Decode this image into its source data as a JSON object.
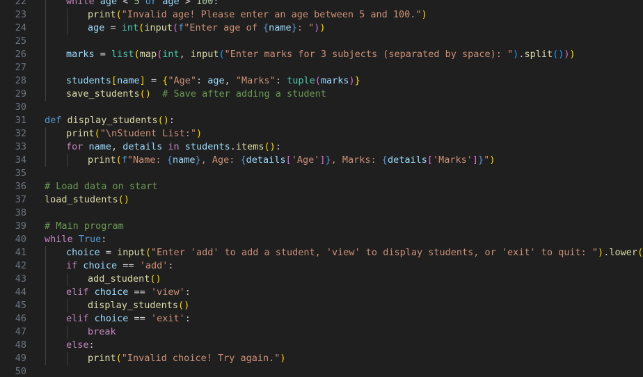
{
  "editor": {
    "language": "python",
    "theme": "dark",
    "colors": {
      "background": "#1f1f1f",
      "line_number": "#6e7681",
      "keyword": "#569cd6",
      "control": "#c586c0",
      "function": "#dcdcaa",
      "variable": "#9cdcfe",
      "string": "#ce9178",
      "number": "#b5cea8",
      "comment": "#6a9955",
      "bracket_1": "#ffd700",
      "bracket_2": "#da70d6",
      "bracket_3": "#179fff"
    },
    "lines": [
      {
        "number": "22",
        "indent": 1,
        "tokens": [
          {
            "t": "while",
            "c": "ctrl"
          },
          {
            "t": " age ",
            "c": "var"
          },
          {
            "t": "< ",
            "c": "op"
          },
          {
            "t": "5",
            "c": "num"
          },
          {
            "t": " or ",
            "c": "kw"
          },
          {
            "t": "age",
            "c": "var"
          },
          {
            "t": " > ",
            "c": "op"
          },
          {
            "t": "100",
            "c": "num"
          },
          {
            "t": ":",
            "c": "plain"
          }
        ]
      },
      {
        "number": "23",
        "indent": 2,
        "tokens": [
          {
            "t": "print",
            "c": "fn"
          },
          {
            "t": "(",
            "c": "p1"
          },
          {
            "t": "\"Invalid age! Please enter an age between 5 and 100.\"",
            "c": "str"
          },
          {
            "t": ")",
            "c": "p1"
          }
        ]
      },
      {
        "number": "24",
        "indent": 2,
        "tokens": [
          {
            "t": "age",
            "c": "var"
          },
          {
            "t": " = ",
            "c": "op"
          },
          {
            "t": "int",
            "c": "type"
          },
          {
            "t": "(",
            "c": "p1"
          },
          {
            "t": "input",
            "c": "fn"
          },
          {
            "t": "(",
            "c": "p2"
          },
          {
            "t": "f",
            "c": "kw"
          },
          {
            "t": "\"Enter age of ",
            "c": "str"
          },
          {
            "t": "{",
            "c": "kw"
          },
          {
            "t": "name",
            "c": "var"
          },
          {
            "t": "}",
            "c": "kw"
          },
          {
            "t": ": \"",
            "c": "str"
          },
          {
            "t": ")",
            "c": "p2"
          },
          {
            "t": ")",
            "c": "p1"
          }
        ]
      },
      {
        "number": "25",
        "indent": 1,
        "tokens": []
      },
      {
        "number": "26",
        "indent": 1,
        "tokens": [
          {
            "t": "marks",
            "c": "var"
          },
          {
            "t": " = ",
            "c": "op"
          },
          {
            "t": "list",
            "c": "type"
          },
          {
            "t": "(",
            "c": "p1"
          },
          {
            "t": "map",
            "c": "fn"
          },
          {
            "t": "(",
            "c": "p2"
          },
          {
            "t": "int",
            "c": "type"
          },
          {
            "t": ", ",
            "c": "plain"
          },
          {
            "t": "input",
            "c": "fn"
          },
          {
            "t": "(",
            "c": "p3"
          },
          {
            "t": "\"Enter marks for 3 subjects (separated by space): \"",
            "c": "str"
          },
          {
            "t": ")",
            "c": "p3"
          },
          {
            "t": ".",
            "c": "plain"
          },
          {
            "t": "split",
            "c": "fn"
          },
          {
            "t": "(",
            "c": "p3"
          },
          {
            "t": ")",
            "c": "p3"
          },
          {
            "t": ")",
            "c": "p2"
          },
          {
            "t": ")",
            "c": "p1"
          }
        ]
      },
      {
        "number": "27",
        "indent": 1,
        "tokens": []
      },
      {
        "number": "28",
        "indent": 1,
        "tokens": [
          {
            "t": "students",
            "c": "var"
          },
          {
            "t": "[",
            "c": "p1"
          },
          {
            "t": "name",
            "c": "var"
          },
          {
            "t": "]",
            "c": "p1"
          },
          {
            "t": " = ",
            "c": "op"
          },
          {
            "t": "{",
            "c": "p1"
          },
          {
            "t": "\"Age\"",
            "c": "str"
          },
          {
            "t": ": ",
            "c": "plain"
          },
          {
            "t": "age",
            "c": "var"
          },
          {
            "t": ", ",
            "c": "plain"
          },
          {
            "t": "\"Marks\"",
            "c": "str"
          },
          {
            "t": ": ",
            "c": "plain"
          },
          {
            "t": "tuple",
            "c": "type"
          },
          {
            "t": "(",
            "c": "p2"
          },
          {
            "t": "marks",
            "c": "var"
          },
          {
            "t": ")",
            "c": "p2"
          },
          {
            "t": "}",
            "c": "p1"
          }
        ]
      },
      {
        "number": "29",
        "indent": 1,
        "tokens": [
          {
            "t": "save_students",
            "c": "fn"
          },
          {
            "t": "(",
            "c": "p1"
          },
          {
            "t": ")",
            "c": "p1"
          },
          {
            "t": "  ",
            "c": "plain"
          },
          {
            "t": "# Save after adding a student",
            "c": "com"
          }
        ]
      },
      {
        "number": "30",
        "indent": 0,
        "tokens": []
      },
      {
        "number": "31",
        "indent": 0,
        "tokens": [
          {
            "t": "def",
            "c": "kw"
          },
          {
            "t": " ",
            "c": "plain"
          },
          {
            "t": "display_students",
            "c": "fn"
          },
          {
            "t": "(",
            "c": "p1"
          },
          {
            "t": ")",
            "c": "p1"
          },
          {
            "t": ":",
            "c": "plain"
          }
        ]
      },
      {
        "number": "32",
        "indent": 1,
        "tokens": [
          {
            "t": "print",
            "c": "fn"
          },
          {
            "t": "(",
            "c": "p1"
          },
          {
            "t": "\"",
            "c": "str"
          },
          {
            "t": "\\n",
            "c": "str"
          },
          {
            "t": "Student List:\"",
            "c": "str"
          },
          {
            "t": ")",
            "c": "p1"
          }
        ]
      },
      {
        "number": "33",
        "indent": 1,
        "tokens": [
          {
            "t": "for",
            "c": "ctrl"
          },
          {
            "t": " name",
            "c": "var"
          },
          {
            "t": ", ",
            "c": "plain"
          },
          {
            "t": "details",
            "c": "var"
          },
          {
            "t": " in ",
            "c": "ctrl"
          },
          {
            "t": "students",
            "c": "var"
          },
          {
            "t": ".",
            "c": "plain"
          },
          {
            "t": "items",
            "c": "fn"
          },
          {
            "t": "(",
            "c": "p1"
          },
          {
            "t": ")",
            "c": "p1"
          },
          {
            "t": ":",
            "c": "plain"
          }
        ]
      },
      {
        "number": "34",
        "indent": 2,
        "tokens": [
          {
            "t": "print",
            "c": "fn"
          },
          {
            "t": "(",
            "c": "p1"
          },
          {
            "t": "f",
            "c": "kw"
          },
          {
            "t": "\"Name: ",
            "c": "str"
          },
          {
            "t": "{",
            "c": "kw"
          },
          {
            "t": "name",
            "c": "var"
          },
          {
            "t": "}",
            "c": "kw"
          },
          {
            "t": ", Age: ",
            "c": "str"
          },
          {
            "t": "{",
            "c": "kw"
          },
          {
            "t": "details",
            "c": "var"
          },
          {
            "t": "[",
            "c": "p2"
          },
          {
            "t": "'Age'",
            "c": "str"
          },
          {
            "t": "]",
            "c": "p2"
          },
          {
            "t": "}",
            "c": "kw"
          },
          {
            "t": ", Marks: ",
            "c": "str"
          },
          {
            "t": "{",
            "c": "kw"
          },
          {
            "t": "details",
            "c": "var"
          },
          {
            "t": "[",
            "c": "p2"
          },
          {
            "t": "'Marks'",
            "c": "str"
          },
          {
            "t": "]",
            "c": "p2"
          },
          {
            "t": "}",
            "c": "kw"
          },
          {
            "t": "\"",
            "c": "str"
          },
          {
            "t": ")",
            "c": "p1"
          }
        ]
      },
      {
        "number": "35",
        "indent": 0,
        "tokens": []
      },
      {
        "number": "36",
        "indent": 0,
        "tokens": [
          {
            "t": "# Load data on start",
            "c": "com"
          }
        ]
      },
      {
        "number": "37",
        "indent": 0,
        "tokens": [
          {
            "t": "load_students",
            "c": "fn"
          },
          {
            "t": "(",
            "c": "p1"
          },
          {
            "t": ")",
            "c": "p1"
          }
        ]
      },
      {
        "number": "38",
        "indent": 0,
        "tokens": []
      },
      {
        "number": "39",
        "indent": 0,
        "tokens": [
          {
            "t": "# Main program",
            "c": "com"
          }
        ]
      },
      {
        "number": "40",
        "indent": 0,
        "tokens": [
          {
            "t": "while",
            "c": "ctrl"
          },
          {
            "t": " ",
            "c": "plain"
          },
          {
            "t": "True",
            "c": "const"
          },
          {
            "t": ":",
            "c": "plain"
          }
        ]
      },
      {
        "number": "41",
        "indent": 1,
        "tokens": [
          {
            "t": "choice",
            "c": "var"
          },
          {
            "t": " = ",
            "c": "op"
          },
          {
            "t": "input",
            "c": "fn"
          },
          {
            "t": "(",
            "c": "p1"
          },
          {
            "t": "\"Enter 'add' to add a student, 'view' to display students, or 'exit' to quit: \"",
            "c": "str"
          },
          {
            "t": ")",
            "c": "p1"
          },
          {
            "t": ".",
            "c": "plain"
          },
          {
            "t": "lower",
            "c": "fn"
          },
          {
            "t": "(",
            "c": "p1"
          },
          {
            "t": ")",
            "c": "p1"
          }
        ]
      },
      {
        "number": "42",
        "indent": 1,
        "tokens": [
          {
            "t": "if",
            "c": "ctrl"
          },
          {
            "t": " choice",
            "c": "var"
          },
          {
            "t": " == ",
            "c": "op"
          },
          {
            "t": "'add'",
            "c": "str"
          },
          {
            "t": ":",
            "c": "plain"
          }
        ]
      },
      {
        "number": "43",
        "indent": 2,
        "tokens": [
          {
            "t": "add_student",
            "c": "fn"
          },
          {
            "t": "(",
            "c": "p1"
          },
          {
            "t": ")",
            "c": "p1"
          }
        ]
      },
      {
        "number": "44",
        "indent": 1,
        "tokens": [
          {
            "t": "elif",
            "c": "ctrl"
          },
          {
            "t": " choice",
            "c": "var"
          },
          {
            "t": " == ",
            "c": "op"
          },
          {
            "t": "'view'",
            "c": "str"
          },
          {
            "t": ":",
            "c": "plain"
          }
        ]
      },
      {
        "number": "45",
        "indent": 2,
        "tokens": [
          {
            "t": "display_students",
            "c": "fn"
          },
          {
            "t": "(",
            "c": "p1"
          },
          {
            "t": ")",
            "c": "p1"
          }
        ]
      },
      {
        "number": "46",
        "indent": 1,
        "tokens": [
          {
            "t": "elif",
            "c": "ctrl"
          },
          {
            "t": " choice",
            "c": "var"
          },
          {
            "t": " == ",
            "c": "op"
          },
          {
            "t": "'exit'",
            "c": "str"
          },
          {
            "t": ":",
            "c": "plain"
          }
        ]
      },
      {
        "number": "47",
        "indent": 2,
        "tokens": [
          {
            "t": "break",
            "c": "ctrl"
          }
        ]
      },
      {
        "number": "48",
        "indent": 1,
        "tokens": [
          {
            "t": "else",
            "c": "ctrl"
          },
          {
            "t": ":",
            "c": "plain"
          }
        ]
      },
      {
        "number": "49",
        "indent": 2,
        "tokens": [
          {
            "t": "print",
            "c": "fn"
          },
          {
            "t": "(",
            "c": "p1"
          },
          {
            "t": "\"Invalid choice! Try again.\"",
            "c": "str"
          },
          {
            "t": ")",
            "c": "p1"
          }
        ]
      },
      {
        "number": "50",
        "indent": 0,
        "tokens": []
      }
    ]
  }
}
